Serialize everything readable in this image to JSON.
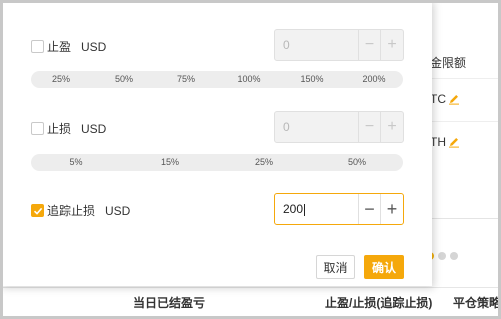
{
  "background": {
    "rows": [
      {
        "text": "金限额",
        "editable": false
      },
      {
        "text": "TC",
        "editable": true
      },
      {
        "text": "TH",
        "editable": true
      }
    ],
    "footer": {
      "col1": "当日已结盈亏",
      "col2": "止盈/止损(追踪止损)",
      "col3": "平仓策略"
    },
    "pagination_dots": 3,
    "active_dot": 0
  },
  "modal": {
    "take_profit": {
      "label": "止盈",
      "unit": "USD",
      "checked": false,
      "value": "0",
      "ratios": [
        "25%",
        "50%",
        "75%",
        "100%",
        "150%",
        "200%"
      ]
    },
    "stop_loss": {
      "label": "止损",
      "unit": "USD",
      "checked": false,
      "value": "0",
      "ratios": [
        "5%",
        "15%",
        "25%",
        "50%"
      ]
    },
    "trailing_stop": {
      "label": "追踪止损",
      "unit": "USD",
      "checked": true,
      "value": "200"
    },
    "stepper_minus": "−",
    "stepper_plus": "+",
    "cancel_label": "取消",
    "confirm_label": "确认"
  },
  "colors": {
    "accent": "#f5a80b",
    "dot_active": "#f5b20c",
    "dot_inactive": "#d5d5d5"
  }
}
